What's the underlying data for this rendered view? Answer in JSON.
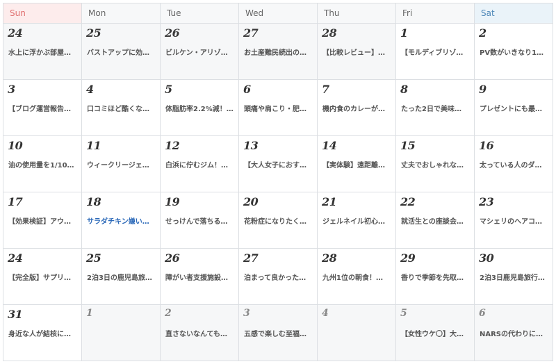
{
  "weekdays": [
    "Sun",
    "Mon",
    "Tue",
    "Wed",
    "Thu",
    "Fri",
    "Sat"
  ],
  "weeks": [
    [
      {
        "day": "24",
        "title": "水上に浮かぶ部屋…",
        "gray": true
      },
      {
        "day": "25",
        "title": "バストアップに効…",
        "gray": true
      },
      {
        "day": "26",
        "title": "ビルケン・アリゾ…",
        "gray": true
      },
      {
        "day": "27",
        "title": "お土産難民続出の…",
        "gray": true
      },
      {
        "day": "28",
        "title": "【比較レビュー】…",
        "gray": true
      },
      {
        "day": "1",
        "title": "【モルディブリゾ…",
        "gray": false
      },
      {
        "day": "2",
        "title": "PV数がいきなり1…",
        "gray": false
      }
    ],
    [
      {
        "day": "3",
        "title": "【ブログ運営報告…"
      },
      {
        "day": "4",
        "title": "口コミほど酷くな…"
      },
      {
        "day": "5",
        "title": "体脂肪率2.2%減！…"
      },
      {
        "day": "6",
        "title": "頭痛や肩こり・肥…"
      },
      {
        "day": "7",
        "title": "機内食のカレーが…"
      },
      {
        "day": "8",
        "title": "たった2日で美味…"
      },
      {
        "day": "9",
        "title": "プレゼントにも最…"
      }
    ],
    [
      {
        "day": "10",
        "title": "油の使用量を1/10…"
      },
      {
        "day": "11",
        "title": "ウィークリージェ…"
      },
      {
        "day": "12",
        "title": "白浜に佇むジム！…"
      },
      {
        "day": "13",
        "title": "【大人女子におす…"
      },
      {
        "day": "14",
        "title": "【実体験】遠距離…"
      },
      {
        "day": "15",
        "title": "丈夫でおしゃれな…"
      },
      {
        "day": "16",
        "title": "太っている人のダ…"
      }
    ],
    [
      {
        "day": "17",
        "title": "【効果検証】アウ…"
      },
      {
        "day": "18",
        "title": "サラダチキン嫌い…",
        "link": true
      },
      {
        "day": "19",
        "title": "せっけんで落ちる…"
      },
      {
        "day": "20",
        "title": "花粉症になりたく…"
      },
      {
        "day": "21",
        "title": "ジェルネイル初心…"
      },
      {
        "day": "22",
        "title": "就活生との座談会…"
      },
      {
        "day": "23",
        "title": "マシェリのヘアコ…"
      }
    ],
    [
      {
        "day": "24",
        "title": "【完全版】サプリ…"
      },
      {
        "day": "25",
        "title": "2泊3日の鹿児島旅…"
      },
      {
        "day": "26",
        "title": "障がい者支援施設…"
      },
      {
        "day": "27",
        "title": "泊まって良かった…"
      },
      {
        "day": "28",
        "title": "九州1位の朝食！…"
      },
      {
        "day": "29",
        "title": "香りで季節を先取…"
      },
      {
        "day": "30",
        "title": "2泊3日鹿児島旅行…"
      }
    ],
    [
      {
        "day": "31",
        "title": "身近な人が結核に…",
        "gray": false
      },
      {
        "day": "1",
        "title": "",
        "gray": true,
        "other": true
      },
      {
        "day": "2",
        "title": "直さないなんても…",
        "gray": true,
        "other": true
      },
      {
        "day": "3",
        "title": "五感で楽しむ至福…",
        "gray": true,
        "other": true
      },
      {
        "day": "4",
        "title": "",
        "gray": true,
        "other": true
      },
      {
        "day": "5",
        "title": "【女性ウケ〇】大…",
        "gray": true,
        "other": true
      },
      {
        "day": "6",
        "title": "NARSの代わりに…",
        "gray": true,
        "other": true
      }
    ]
  ],
  "colors": {
    "sunday_header": "#e07070",
    "saturday_header": "#4f88b8",
    "link_post": "#2a68b8"
  }
}
